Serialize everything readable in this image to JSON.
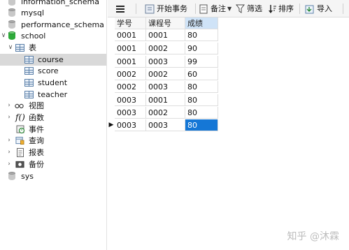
{
  "navigator": {
    "items": [
      {
        "label": "information_schema",
        "kind": "database"
      },
      {
        "label": "mysql",
        "kind": "database"
      },
      {
        "label": "performance_schema",
        "kind": "database"
      },
      {
        "label": "school",
        "kind": "database-open"
      },
      {
        "label": "表",
        "kind": "folder-tables"
      },
      {
        "label": "course",
        "kind": "table",
        "selected": true
      },
      {
        "label": "score",
        "kind": "table"
      },
      {
        "label": "student",
        "kind": "table"
      },
      {
        "label": "teacher",
        "kind": "table"
      },
      {
        "label": "视图",
        "kind": "views"
      },
      {
        "label": "函数",
        "kind": "functions"
      },
      {
        "label": "事件",
        "kind": "events"
      },
      {
        "label": "查询",
        "kind": "queries"
      },
      {
        "label": "报表",
        "kind": "reports"
      },
      {
        "label": "备份",
        "kind": "backups"
      },
      {
        "label": "sys",
        "kind": "database"
      }
    ]
  },
  "toolbar": {
    "menu_icon": "hamburger-icon",
    "begin_transaction": "开始事务",
    "memo": "备注",
    "filter": "筛选",
    "sort": "排序",
    "import": "导入"
  },
  "table": {
    "columns": [
      "学号",
      "课程号",
      "成绩"
    ],
    "rows": [
      [
        "0001",
        "0001",
        "80"
      ],
      [
        "0001",
        "0002",
        "90"
      ],
      [
        "0001",
        "0003",
        "99"
      ],
      [
        "0002",
        "0002",
        "60"
      ],
      [
        "0002",
        "0003",
        "80"
      ],
      [
        "0003",
        "0001",
        "80"
      ],
      [
        "0003",
        "0002",
        "80"
      ],
      [
        "0003",
        "0003",
        "80"
      ]
    ],
    "current_row_marker": "▶"
  },
  "watermark": "知乎 @沐霖",
  "colors": {
    "selection": "#1577d6",
    "nav_selected": "#d9d9d9",
    "school_db": "#2eaa3a"
  }
}
